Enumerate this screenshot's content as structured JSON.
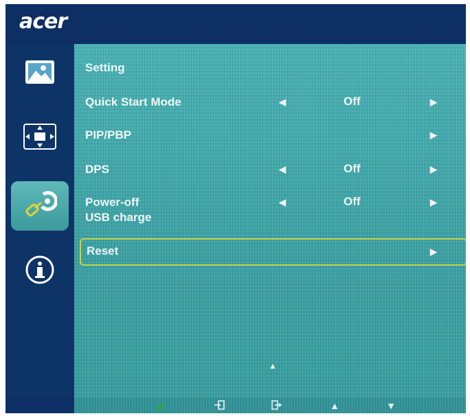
{
  "brand": {
    "logo_text": "acer"
  },
  "sidebar": {
    "items": [
      {
        "icon": "picture-icon",
        "active": false
      },
      {
        "icon": "display-position-icon",
        "active": false
      },
      {
        "icon": "setting-wrench-icon",
        "active": true
      },
      {
        "icon": "info-icon",
        "active": false
      }
    ]
  },
  "menu": {
    "title": "Setting",
    "rows": [
      {
        "label": "Quick Start Mode",
        "value": "Off",
        "has_left_arrow": true,
        "has_right_arrow": true
      },
      {
        "label": "PIP/PBP",
        "value": "",
        "has_left_arrow": false,
        "has_right_arrow": true
      },
      {
        "label": "DPS",
        "value": "Off",
        "has_left_arrow": true,
        "has_right_arrow": true
      },
      {
        "label_line1": "Power-off",
        "label_line2": "USB charge",
        "value": "Off",
        "has_left_arrow": true,
        "has_right_arrow": true
      },
      {
        "label": "Reset",
        "value": "",
        "has_left_arrow": false,
        "has_right_arrow": true,
        "selected": true
      }
    ]
  },
  "arrows": {
    "left": "◀",
    "right": "▶",
    "up": "▲",
    "down": "▼"
  },
  "bottom_bar": {
    "buttons": [
      {
        "icon": "e-key-icon",
        "glyph": "e"
      },
      {
        "icon": "input-icon",
        "glyph": ""
      },
      {
        "icon": "exit-icon",
        "glyph": ""
      },
      {
        "icon": "up-arrow-icon",
        "glyph": "▲"
      },
      {
        "icon": "down-arrow-icon",
        "glyph": "▼"
      }
    ]
  },
  "colors": {
    "frame": "#0d2f63",
    "panel": "#3ea6a8",
    "highlight": "#c7d44a",
    "e_key": "#2aa84a"
  }
}
